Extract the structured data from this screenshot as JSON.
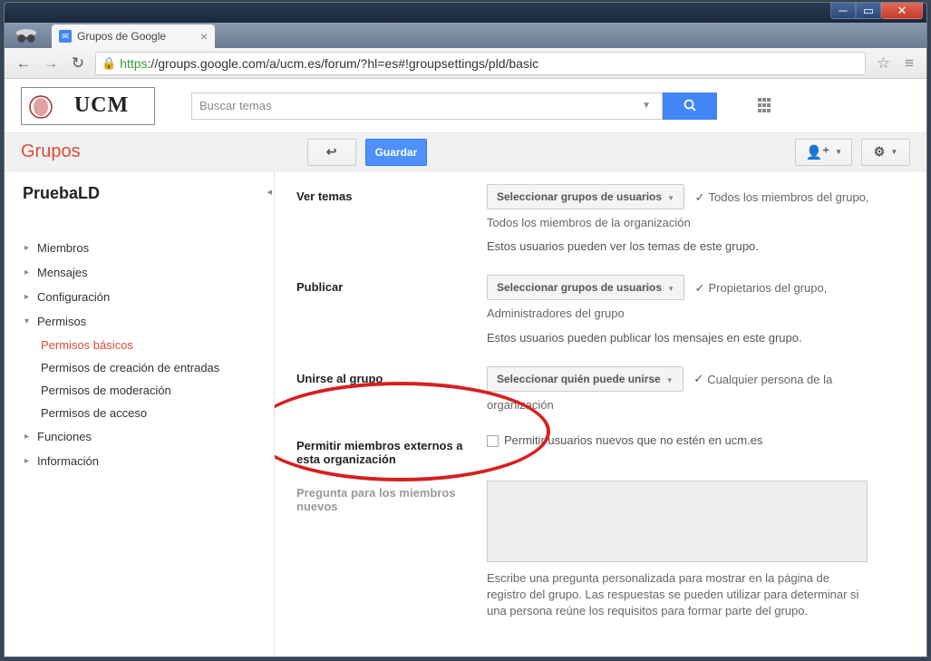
{
  "browser": {
    "tab_title": "Grupos de Google",
    "url_https": "https",
    "url_rest": "://groups.google.com/a/ucm.es/forum/?hl=es#!groupsettings/pld/basic"
  },
  "header": {
    "logo_text": "UCM",
    "search_placeholder": "Buscar temas"
  },
  "toolbar": {
    "app_title": "Grupos",
    "back_label": "↩",
    "save_label": "Guardar"
  },
  "sidebar": {
    "group_name": "PruebaLD",
    "items": [
      {
        "label": "Miembros"
      },
      {
        "label": "Mensajes"
      },
      {
        "label": "Configuración"
      },
      {
        "label": "Permisos",
        "expanded": true,
        "children": [
          {
            "label": "Permisos básicos",
            "active": true
          },
          {
            "label": "Permisos de creación de entradas"
          },
          {
            "label": "Permisos de moderación"
          },
          {
            "label": "Permisos de acceso"
          }
        ]
      },
      {
        "label": "Funciones"
      },
      {
        "label": "Información"
      }
    ]
  },
  "settings": {
    "view_topics": {
      "label": "Ver temas",
      "selector": "Seleccionar grupos de usuarios",
      "summary": "Todos los miembros del grupo,",
      "desc1": "Todos los miembros de la organización",
      "desc2": "Estos usuarios pueden ver los temas de este grupo."
    },
    "post": {
      "label": "Publicar",
      "selector": "Seleccionar grupos de usuarios",
      "summary": "Propietarios del grupo,",
      "desc1": "Administradores del grupo",
      "desc2": "Estos usuarios pueden publicar los mensajes en este grupo."
    },
    "join": {
      "label": "Unirse al grupo",
      "selector": "Seleccionar quién puede unirse",
      "summary": "Cualquier persona de la",
      "desc1": "organización"
    },
    "external": {
      "label": "Permitir miembros externos a esta organización",
      "checkbox_label": "Permitir usuarios nuevos que no estén en ucm.es"
    },
    "question": {
      "label": "Pregunta para los miembros nuevos",
      "help": "Escribe una pregunta personalizada para mostrar en la página de registro del grupo. Las respuestas se pueden utilizar para determinar si una persona reúne los requisitos para formar parte del grupo."
    }
  }
}
